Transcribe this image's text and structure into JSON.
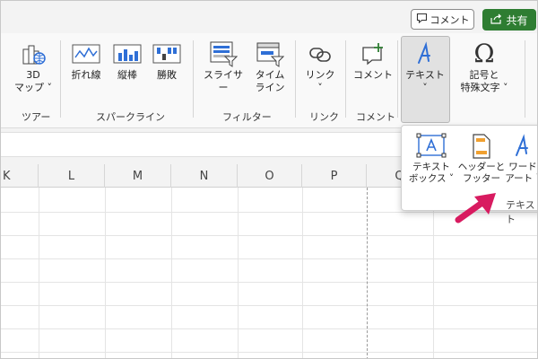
{
  "topbar": {
    "comment_label": "コメント",
    "share_label": "共有"
  },
  "ribbon": {
    "map3d": {
      "line1": "3D",
      "line2": "マップ ˅"
    },
    "tours_label": "ツアー",
    "sparkline_line": "折れ線",
    "sparkline_column": "縦棒",
    "sparkline_winloss": "勝敗",
    "sparklines_label": "スパークライン",
    "slicer": "スライサー",
    "timeline_line1": "タイム",
    "timeline_line2": "ライン",
    "filters_label": "フィルター",
    "link_label": "リンク",
    "link_chevron": "˅",
    "links_group_label": "リンク",
    "comment_label": "コメント",
    "comments_group_label": "コメント",
    "text_label": "テキスト",
    "text_chevron": "˅",
    "symbols_line1": "記号と",
    "symbols_line2": "特殊文字 ˅"
  },
  "sheet": {
    "columns": [
      "K",
      "L",
      "M",
      "N",
      "O",
      "P",
      "Q"
    ]
  },
  "dropdown": {
    "textbox_line1": "テキスト",
    "textbox_line2": "ボックス ˅",
    "headerfooter_line1": "ヘッダーと",
    "headerfooter_line2": "フッター",
    "wordart_line1": "ワード",
    "wordart_line2": "アート ˅",
    "group_label": "テキスト"
  },
  "colors": {
    "accent_blue": "#2f6fd6",
    "share_green": "#2e7d32",
    "arrow_pink": "#d81b60"
  }
}
